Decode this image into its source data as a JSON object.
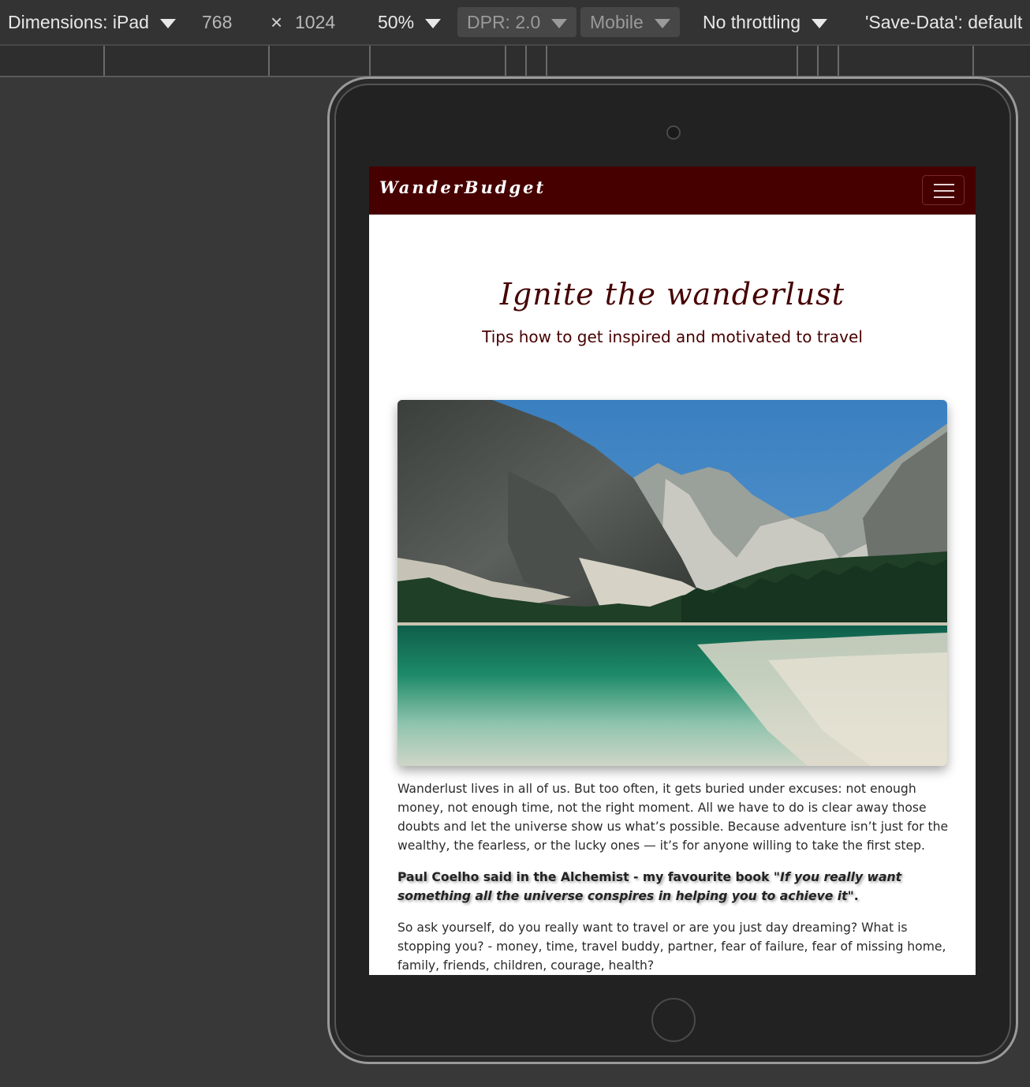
{
  "devtools": {
    "dimensions_label": "Dimensions: iPad",
    "width": "768",
    "times": "×",
    "height": "1024",
    "zoom": "50%",
    "dpr": "DPR: 2.0",
    "device_type": "Mobile",
    "throttling": "No throttling",
    "save_data": "'Save-Data': default"
  },
  "site": {
    "brand": "WanderBudget",
    "hero_title": "Ignite the wanderlust",
    "hero_subtitle": "Tips how to get inspired and motivated to travel",
    "paragraph_1": "Wanderlust lives in all of us. But too often, it gets buried under excuses: not enough money, not enough time, not the right moment. All we have to do is clear away those doubts and let the universe show us what’s possible. Because adventure isn’t just for the wealthy, the fearless, or the lucky ones — it’s for anyone willing to take the first step.",
    "quote_intro": "Paul Coelho said in the Alchemist - my favourite book ",
    "quote_text": "\"If you really want something all the universe conspires in helping you to achieve it\"",
    "quote_end": ".",
    "paragraph_3": "So ask yourself, do you really want to travel or are you just day dreaming? What is stopping you? - money, time, travel buddy, partner, fear of failure, fear of missing home, family, friends, children, courage, health?"
  },
  "colors": {
    "navbar_bg": "#460000",
    "heading": "#460000",
    "lake": "#1f8a6a",
    "sky": "#3f86c6"
  }
}
